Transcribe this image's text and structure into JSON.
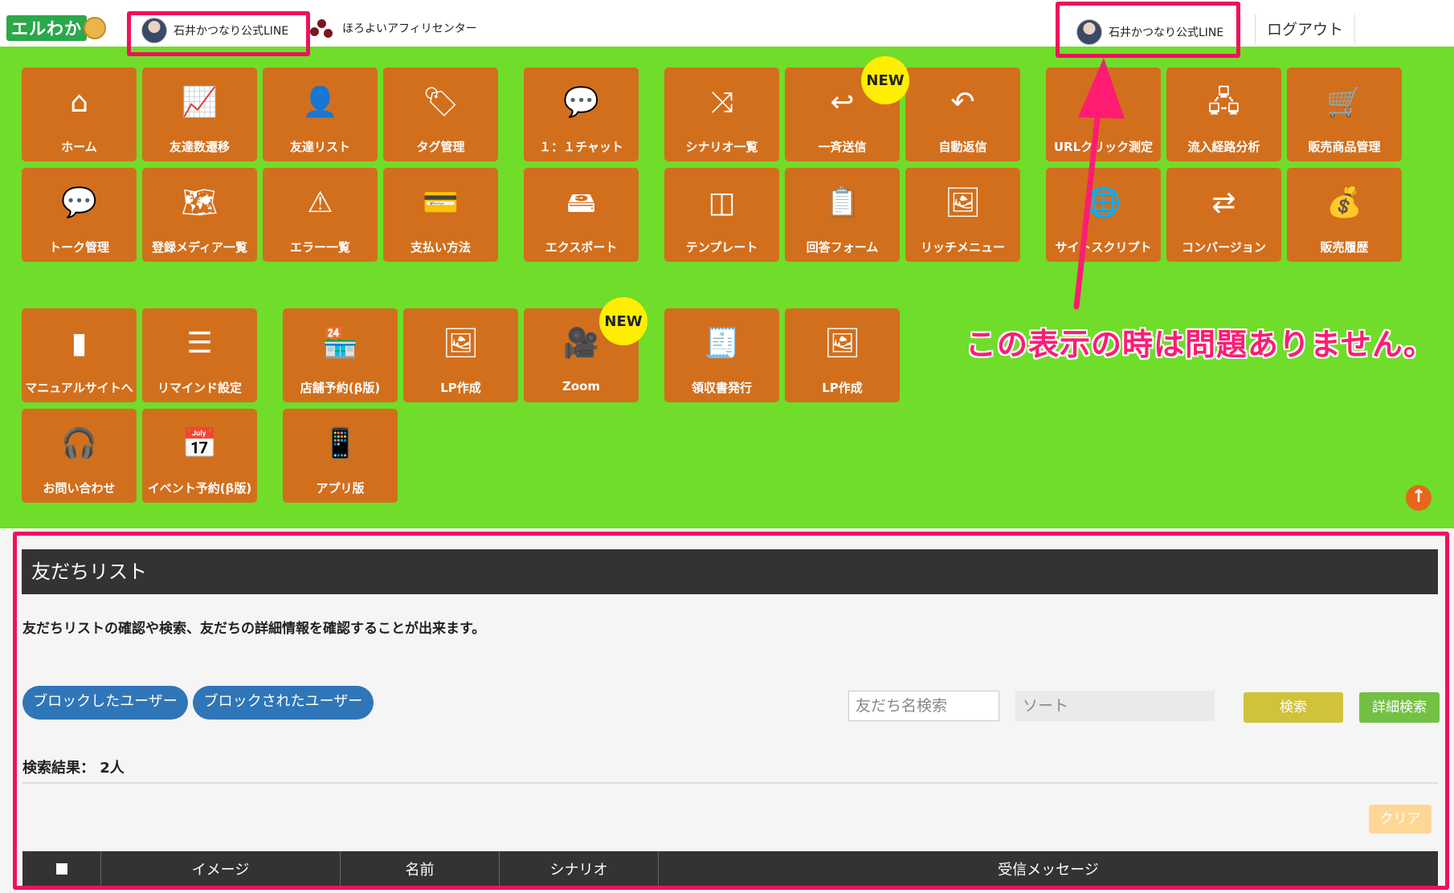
{
  "header": {
    "logo_text": "エルわか",
    "account_left": "石井かつなり公式LINE",
    "affiliate": "ほろよいアフィリセンター",
    "account_right": "石井かつなり公式LINE",
    "logout": "ログアウト"
  },
  "menu": {
    "tiles": [
      {
        "id": "home",
        "label": "ホーム",
        "icon": "⌂",
        "icon_name": "home-icon"
      },
      {
        "id": "friend-trend",
        "label": "友達数遷移",
        "icon": "📈",
        "icon_name": "line-chart-icon"
      },
      {
        "id": "friend-list",
        "label": "友達リスト",
        "icon": "👤",
        "icon_name": "user-icon"
      },
      {
        "id": "tag",
        "label": "タグ管理",
        "icon": "🏷",
        "icon_name": "tags-icon"
      },
      {
        "id": "chat",
        "label": "１：１チャット",
        "icon": "💬",
        "icon_name": "chat-icon"
      },
      {
        "id": "scenario",
        "label": "シナリオ一覧",
        "icon": "⤨",
        "icon_name": "shuffle-icon"
      },
      {
        "id": "broadcast",
        "label": "一斉送信",
        "icon": "↩",
        "icon_name": "reply-icon"
      },
      {
        "id": "auto-reply",
        "label": "自動返信",
        "icon": "↶",
        "icon_name": "undo-icon"
      },
      {
        "id": "url-click",
        "label": "URLクリック測定",
        "icon": "🖱",
        "icon_name": "pointer-icon"
      },
      {
        "id": "inflow",
        "label": "流入経路分析",
        "icon": "🖧",
        "icon_name": "sitemap-icon"
      },
      {
        "id": "products",
        "label": "販売商品管理",
        "icon": "🛒",
        "icon_name": "cart-icon"
      },
      {
        "id": "talk",
        "label": "トーク管理",
        "icon": "💬",
        "icon_name": "speech-bubble-icon"
      },
      {
        "id": "media",
        "label": "登録メディア一覧",
        "icon": "🗺",
        "icon_name": "map-icon"
      },
      {
        "id": "errors",
        "label": "エラー一覧",
        "icon": "⚠",
        "icon_name": "warning-icon"
      },
      {
        "id": "payment",
        "label": "支払い方法",
        "icon": "💳",
        "icon_name": "credit-card-icon"
      },
      {
        "id": "export",
        "label": "エクスポート",
        "icon": "🖴",
        "icon_name": "hdd-icon"
      },
      {
        "id": "template",
        "label": "テンプレート",
        "icon": "◫",
        "icon_name": "columns-icon"
      },
      {
        "id": "form",
        "label": "回答フォーム",
        "icon": "📋",
        "icon_name": "clipboard-icon"
      },
      {
        "id": "rich-menu",
        "label": "リッチメニュー",
        "icon": "🖼",
        "icon_name": "image-icon"
      },
      {
        "id": "site-script",
        "label": "サイトスクリプト",
        "icon": "🌐",
        "icon_name": "www-icon"
      },
      {
        "id": "conversion",
        "label": "コンバージョン",
        "icon": "⇄",
        "icon_name": "exchange-icon"
      },
      {
        "id": "sales-history",
        "label": "販売履歴",
        "icon": "💰",
        "icon_name": "money-bag-icon"
      },
      {
        "id": "manual",
        "label": "マニュアルサイトへ",
        "icon": "▮",
        "icon_name": "book-icon"
      },
      {
        "id": "remind",
        "label": "リマインド設定",
        "icon": "☰",
        "icon_name": "list-icon"
      },
      {
        "id": "store",
        "label": "店舗予約(β版)",
        "icon": "🏪",
        "icon_name": "store-icon"
      },
      {
        "id": "lp1",
        "label": "LP作成",
        "icon": "🖼",
        "icon_name": "webpage-icon"
      },
      {
        "id": "zoom",
        "label": "Zoom",
        "icon": "🎥",
        "icon_name": "video-camera-icon"
      },
      {
        "id": "receipt",
        "label": "領収書発行",
        "icon": "🧾",
        "icon_name": "document-icon"
      },
      {
        "id": "lp2",
        "label": "LP作成",
        "icon": "🖼",
        "icon_name": "webpage-icon"
      },
      {
        "id": "contact",
        "label": "お問い合わせ",
        "icon": "🎧",
        "icon_name": "headset-icon"
      },
      {
        "id": "event",
        "label": "イベント予約(β版)",
        "icon": "📅",
        "icon_name": "calendar-icon"
      },
      {
        "id": "app",
        "label": "アプリ版",
        "icon": "📱",
        "icon_name": "mobile-icon"
      }
    ],
    "new_badge": "NEW"
  },
  "annotation": "この表示の時は問題ありません。",
  "friend_list": {
    "title": "友だちリスト",
    "description": "友だちリストの確認や検索、友だちの詳細情報を確認することが出来ます。",
    "blocked_btn": "ブロックしたユーザー",
    "blocked_by_btn": "ブロックされたユーザー",
    "search_placeholder": "友だち名検索",
    "sort_label": "ソート",
    "search_btn": "検索",
    "advanced_btn": "詳細検索",
    "result_count": "検索結果： 2人",
    "clear_btn": "クリア",
    "columns": [
      "イメージ",
      "名前",
      "シナリオ",
      "受信メッセージ"
    ]
  },
  "colors": {
    "panel_green": "#6fdd2a",
    "tile_orange": "#d26f1d",
    "highlight_pink": "#f0115a",
    "button_blue": "#2f76b8",
    "search_yellow": "#d0c23a",
    "advanced_green": "#74c045"
  }
}
